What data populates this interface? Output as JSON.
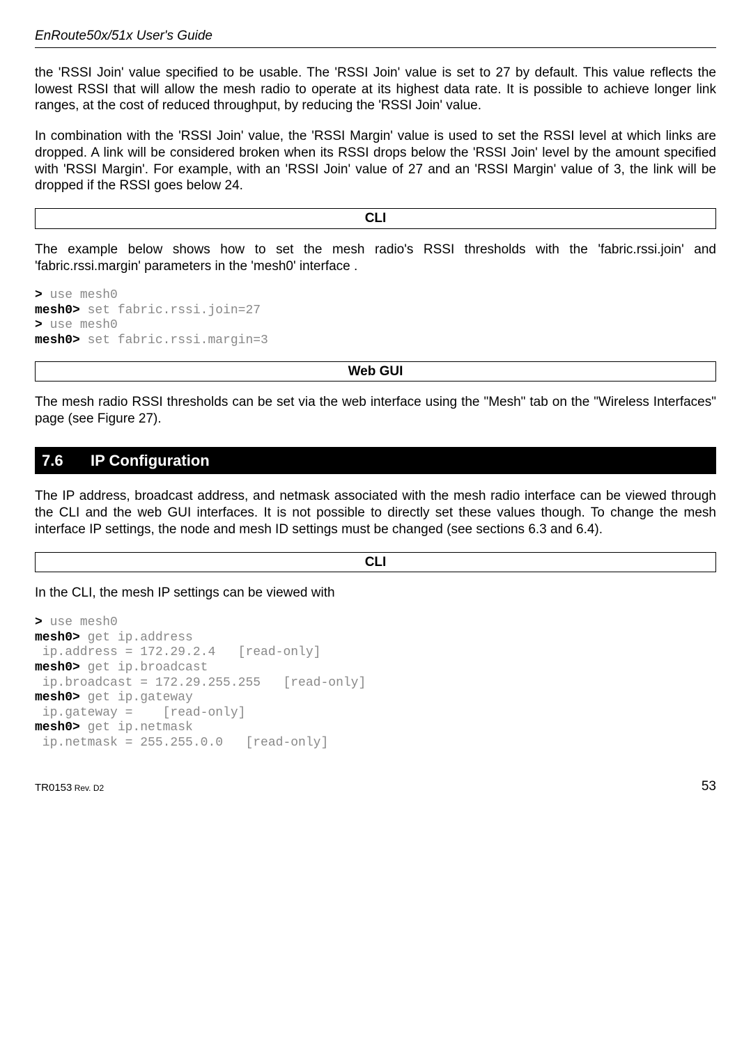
{
  "header": {
    "title": "EnRoute50x/51x User's Guide"
  },
  "body": {
    "p1": "the 'RSSI Join' value specified to be usable. The 'RSSI  Join' value is set to 27 by default. This value reflects the lowest RSSI that will allow the mesh radio to operate at its highest data rate. It is possible to achieve longer link ranges, at the cost of reduced throughput, by reducing the 'RSSI Join' value.",
    "p2": "In combination with the 'RSSI Join' value, the 'RSSI Margin' value is used to set the RSSI level at which links are dropped. A link will be considered broken when its RSSI drops below the 'RSSI Join' level by the amount specified with 'RSSI Margin'. For example, with an 'RSSI Join' value of 27 and an 'RSSI Margin' value of 3, the link will be dropped if the RSSI goes below 24.",
    "cli_label": "CLI",
    "p3": "The example below shows how to set the mesh radio's RSSI thresholds with the 'fabric.rssi.join' and 'fabric.rssi.margin' parameters in the 'mesh0' interface .",
    "term1": {
      "l1p": ">",
      "l1c": " use mesh0",
      "l2p": "mesh0>",
      "l2c": " set fabric.rssi.join=27",
      "l3p": ">",
      "l3c": " use mesh0",
      "l4p": "mesh0>",
      "l4c": " set fabric.rssi.margin=3"
    },
    "webgui_label": "Web GUI",
    "p4": "The mesh radio RSSI thresholds can be set via the web interface using the \"Mesh\" tab on the \"Wireless Interfaces\" page (see Figure 27).",
    "section": {
      "num": "7.6",
      "title": "IP Configuration"
    },
    "p5": "The IP address, broadcast address, and netmask associated with the mesh radio interface can be viewed through the CLI and the web GUI interfaces. It is not possible to directly set these values though. To change the mesh interface IP settings, the node and mesh ID settings must be changed (see sections 6.3 and 6.4).",
    "cli_label2": "CLI",
    "p6": "In the CLI, the mesh IP settings can be viewed with",
    "term2": {
      "l1p": ">",
      "l1c": " use mesh0",
      "l2p": "mesh0>",
      "l2c": " get ip.address",
      "l3": " ip.address = 172.29.2.4   [read-only]",
      "l4p": "mesh0>",
      "l4c": " get ip.broadcast",
      "l5": " ip.broadcast = 172.29.255.255   [read-only]",
      "l6p": "mesh0>",
      "l6c": " get ip.gateway",
      "l7": " ip.gateway =    [read-only]",
      "l8p": "mesh0>",
      "l8c": " get ip.netmask",
      "l9": " ip.netmask = 255.255.0.0   [read-only]"
    }
  },
  "footer": {
    "doc_id": "TR0153",
    "rev": " Rev. D2",
    "page": "53"
  }
}
